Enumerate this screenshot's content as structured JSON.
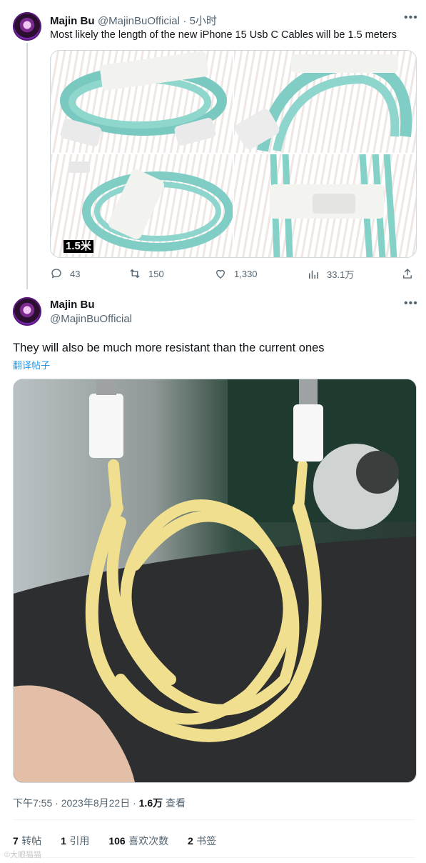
{
  "tweet1": {
    "author_name": "Majin Bu",
    "handle": "@MajinBuOfficial",
    "time": "· 5小时",
    "text": "Most likely the length of the new iPhone 15 Usb C Cables will be 1.5 meters",
    "image_overlay_label": "1.5米",
    "actions": {
      "replies": "43",
      "retweets": "150",
      "likes": "1,330",
      "views": "33.1万"
    }
  },
  "tweet2": {
    "author_name": "Majin Bu",
    "handle": "@MajinBuOfficial",
    "text": "They will also be much more resistant than the current ones",
    "translate_link": "翻译帖子",
    "timestamp": "下午7:55 · 2023年8月22日 ·",
    "view_count": "1.6万",
    "view_label": "查看",
    "stats": [
      {
        "num": "7",
        "label": "转帖"
      },
      {
        "num": "1",
        "label": "引用"
      },
      {
        "num": "106",
        "label": "喜欢次数"
      },
      {
        "num": "2",
        "label": "书签"
      }
    ]
  },
  "colors": {
    "text_primary": "#0f1419",
    "text_secondary": "#536471",
    "link": "#1d9bf0",
    "border": "#cfd9de"
  },
  "watermark": "©大眼猫猫"
}
